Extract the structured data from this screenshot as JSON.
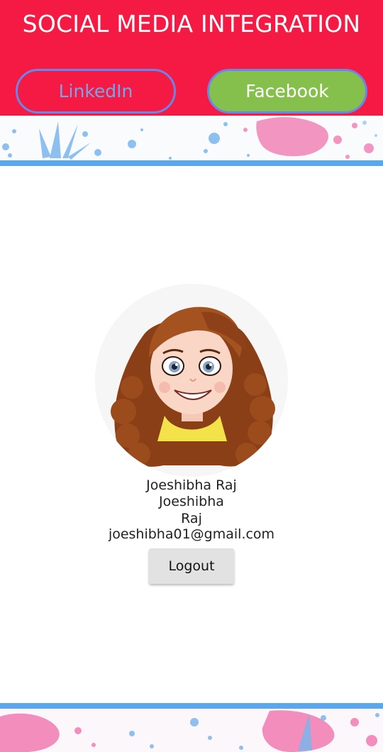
{
  "header": {
    "title": "SOCIAL MEDIA INTEGRATION",
    "linkedin_label": "LinkedIn",
    "facebook_label": "Facebook"
  },
  "profile": {
    "full_name": "Joeshibha Raj",
    "first_name": "Joeshibha",
    "last_name": "Raj",
    "email": "joeshibha01@gmail.com",
    "avatar_icon": "cartoon-girl-avatar-icon"
  },
  "actions": {
    "logout_label": "Logout"
  },
  "colors": {
    "header_bg": "#f41a43",
    "linkedin_text": "#74a6f0",
    "facebook_bg": "#86c04c",
    "button_border": "#6a86e8",
    "accent_line": "#5aa7ef",
    "splash_blue": "#7bb6ee",
    "splash_pink": "#f06aa8"
  }
}
